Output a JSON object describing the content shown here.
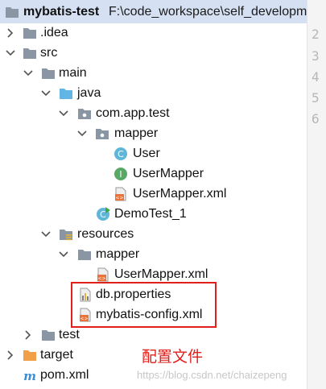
{
  "project": {
    "name": "mybatis-test",
    "path": "F:\\code_workspace\\self_development"
  },
  "tree": [
    {
      "label": "mybatis-test",
      "icon": "folder-icon",
      "expanded": true
    },
    {
      "label": ".idea",
      "icon": "folder-icon",
      "expanded": false
    },
    {
      "label": "src",
      "icon": "folder-icon",
      "expanded": true
    },
    {
      "label": "main",
      "icon": "folder-icon",
      "expanded": true
    },
    {
      "label": "java",
      "icon": "source-folder-icon",
      "expanded": true
    },
    {
      "label": "com.app.test",
      "icon": "package-icon",
      "expanded": true
    },
    {
      "label": "mapper",
      "icon": "package-icon",
      "expanded": true
    },
    {
      "label": "User",
      "icon": "class-icon"
    },
    {
      "label": "UserMapper",
      "icon": "interface-icon"
    },
    {
      "label": "UserMapper.xml",
      "icon": "xml-file-icon"
    },
    {
      "label": "DemoTest_1",
      "icon": "runnable-class-icon"
    },
    {
      "label": "resources",
      "icon": "resources-folder-icon",
      "expanded": true
    },
    {
      "label": "mapper",
      "icon": "folder-icon",
      "expanded": true
    },
    {
      "label": "UserMapper.xml",
      "icon": "xml-file-icon"
    },
    {
      "label": "db.properties",
      "icon": "properties-file-icon"
    },
    {
      "label": "mybatis-config.xml",
      "icon": "xml-file-icon"
    },
    {
      "label": "test",
      "icon": "folder-icon",
      "expanded": false
    },
    {
      "label": "target",
      "icon": "excluded-folder-icon",
      "expanded": false
    },
    {
      "label": "pom.xml",
      "icon": "maven-icon"
    }
  ],
  "gutter": {
    "line_numbers": [
      "2",
      "3",
      "4",
      "5",
      "6"
    ]
  },
  "annotation": {
    "text": "配置文件"
  },
  "watermark": {
    "text": "https://blog.csdn.net/chaizepeng"
  },
  "colors": {
    "selection": "#d5e1f3",
    "highlight_box": "#e0201b",
    "folder": "#8a96a3",
    "source_folder": "#62b6e5",
    "excluded_folder": "#f2a048"
  }
}
